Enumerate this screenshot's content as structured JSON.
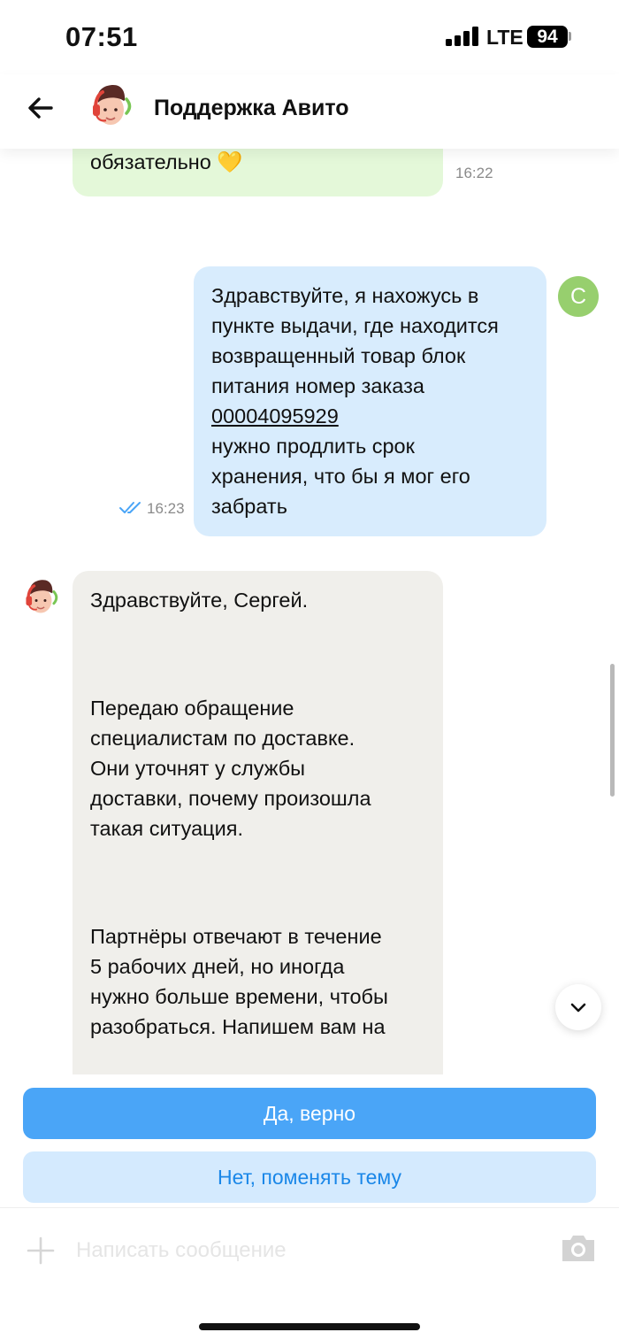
{
  "status_bar": {
    "time": "07:51",
    "network": "LTE",
    "battery": "94"
  },
  "header": {
    "title": "Поддержка Авито",
    "back_icon": "arrow-left-icon",
    "avatar_icon": "support-agent-avatar"
  },
  "messages": [
    {
      "from": "support",
      "text": "обязательно 💛",
      "time": "16:22"
    },
    {
      "from": "user",
      "avatar_letter": "С",
      "line1": "Здравствуйте, я нахожусь в",
      "line2": "пункте выдачи, где находится",
      "line3": "возвращенный товар блок",
      "line4": "питания номер заказа",
      "order_number": "00004095929",
      "line5": "нужно продлить срок",
      "line6": "хранения, что бы я мог его",
      "line7": "забрать",
      "time": "16:23",
      "read": true
    },
    {
      "from": "support",
      "p1": "Здравствуйте, Сергей.",
      "p2_1": "Передаю обращение",
      "p2_2": "специалистам по доставке.",
      "p2_3": "Они уточнят у службы",
      "p2_4": "доставки, почему произошла",
      "p2_5": "такая ситуация.",
      "p3_1": "Партнёры отвечают в течение",
      "p3_2": "5 рабочих дней, но иногда",
      "p3_3": "нужно больше времени, чтобы",
      "p3_4": "разобраться. Напишем вам на"
    }
  ],
  "quick_replies": {
    "yes": "Да, верно",
    "no": "Нет, поменять тему"
  },
  "composer": {
    "placeholder": "Написать сообщение"
  },
  "colors": {
    "accent": "#4aa5f7",
    "accent_light": "#d4eafe",
    "user_bubble": "#d8ecfd",
    "support_bubble": "#f0efeb",
    "green_bubble": "#e4f8d9",
    "user_avatar": "#97cf6e"
  }
}
